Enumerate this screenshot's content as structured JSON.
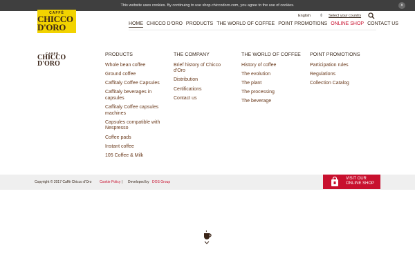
{
  "cookie_bar": {
    "text": "This website uses cookies. By continuing to use shop.chiccodoro.com, you agree to the use of cookies.",
    "close_label": "x"
  },
  "header": {
    "logo": {
      "top_text": "CAFFÈ",
      "main_text": "CHICCO D'ORO"
    },
    "language": "English",
    "select_country": "Select your country",
    "nav": [
      {
        "label": "HOME"
      },
      {
        "label": "CHICCO D'ORO"
      },
      {
        "label": "PRODUCTS"
      },
      {
        "label": "THE WORLD OF COFFEE"
      },
      {
        "label": "POINT PROMOTIONS"
      },
      {
        "label": "ONLINE SHOP"
      },
      {
        "label": "CONTACT US"
      }
    ]
  },
  "footer": {
    "logo": {
      "top_text": "CAFFÈ",
      "line1": "CHICCO",
      "line2": "D'ORO"
    },
    "columns": [
      {
        "heading": "PRODUCTS",
        "items": [
          "Whole bean coffee",
          "Ground coffee",
          "Caffitaly Coffee Capsules",
          "Caffitaly beverages in capsules",
          "Caffitaly Coffee capsules machines",
          "Capsules compatible with Nespresso",
          "Coffee pads",
          "Instant coffee",
          "105 Coffee & Milk"
        ]
      },
      {
        "heading": "THE COMPANY",
        "items": [
          "Brief history of Chicco d'Oro",
          "Distribution",
          "Certifications",
          "Contact us"
        ]
      },
      {
        "heading": "THE WORLD OF COFFEE",
        "items": [
          "History of coffee",
          "The evolution",
          "The plant",
          "The processing",
          "The beverage"
        ]
      },
      {
        "heading": "POINT PROMOTIONS",
        "items": [
          "Participation rules",
          "Regulations",
          "Collection Catalog"
        ]
      }
    ],
    "copyright": "Copyright © 2017 Caffè Chicco d'Oro",
    "cookie_policy": "Cookie Policy",
    "separator": "|",
    "developed_by": "Developed by",
    "developer": "DOS Group",
    "shop_button": {
      "line1": "VISIT OUR",
      "line2": "ONLINE SHOP"
    }
  },
  "colors": {
    "brand_yellow": "#f2d300",
    "brand_red": "#c8102e",
    "brown_text": "#6a3a1c"
  }
}
